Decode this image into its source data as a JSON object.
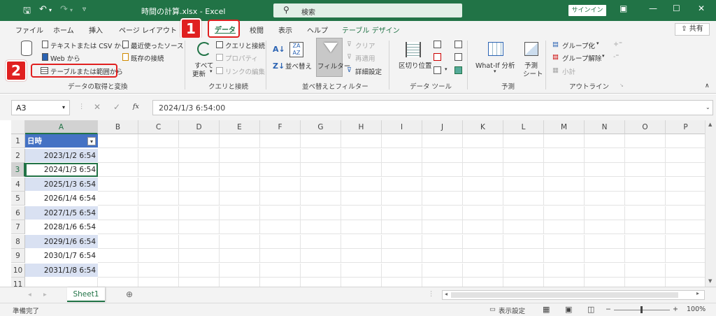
{
  "window": {
    "title": "時間の計算.xlsx  -  Excel",
    "search_label": "検索",
    "signin_label": "サインイン",
    "icons": [
      "save-icon",
      "undo-icon",
      "redo-icon",
      "customize-icon",
      "ribbon-display-icon",
      "minimize-icon",
      "maximize-icon",
      "close-icon"
    ]
  },
  "tabs": [
    {
      "label": "ファイル"
    },
    {
      "label": "ホーム"
    },
    {
      "label": "挿入"
    },
    {
      "label": "ページ レイアウト"
    },
    {
      "label": "データ",
      "active": true
    },
    {
      "label": "校閲"
    },
    {
      "label": "表示"
    },
    {
      "label": "ヘルプ"
    },
    {
      "label": "テーブル デザイン"
    }
  ],
  "share_label": "共有",
  "badges": {
    "step1": "1",
    "step2": "2"
  },
  "ribbon": {
    "get_data": {
      "text_csv": "テキストまたは CSV から",
      "web": "Web から",
      "from_table": "テーブルまたは範囲から",
      "recent_sources": "最近使ったソース",
      "existing_connections": "既存の接続",
      "group": "データの取得と変換"
    },
    "queries": {
      "refresh_all": "すべて",
      "refresh_all_2": "更新",
      "queries_conn": "クエリと接続",
      "properties": "プロパティ",
      "edit_links": "リンクの編集",
      "group": "クエリと接続"
    },
    "sort_filter": {
      "sort": "並べ替え",
      "filter": "フィルター",
      "clear": "クリア",
      "reapply": "再適用",
      "advanced": "詳細設定",
      "group": "並べ替えとフィルター"
    },
    "data_tools": {
      "text_to_columns": "区切り位置",
      "group": "データ ツール"
    },
    "forecast": {
      "whatif": "What-If 分析",
      "forecast_sheet_1": "予測",
      "forecast_sheet_2": "シート",
      "group": "予測"
    },
    "outline": {
      "group_btn": "グループ化",
      "ungroup": "グループ解除",
      "subtotal": "小計",
      "group": "アウトライン"
    }
  },
  "formula_bar": {
    "name_box": "A3",
    "fx": "fx",
    "value": "2024/1/3  6:54:00"
  },
  "columns": [
    "A",
    "B",
    "C",
    "D",
    "E",
    "F",
    "G",
    "H",
    "I",
    "J",
    "K",
    "L",
    "M",
    "N",
    "O",
    "P"
  ],
  "rows": [
    "1",
    "2",
    "3",
    "4",
    "5",
    "6",
    "7",
    "8",
    "9",
    "10",
    "11"
  ],
  "table": {
    "header": "日時",
    "values": [
      "2023/1/2 6:54",
      "2024/1/3 6:54",
      "2025/1/3 6:54",
      "2026/1/4 6:54",
      "2027/1/5 6:54",
      "2028/1/6 6:54",
      "2029/1/6 6:54",
      "2030/1/7 6:54",
      "2031/1/8 6:54"
    ],
    "header_color": "#4472c4",
    "band_color": "#d9e1f2"
  },
  "sheet_tab": "Sheet1",
  "status": {
    "ready": "準備完了",
    "display_settings": "表示設定",
    "zoom": "100%"
  }
}
